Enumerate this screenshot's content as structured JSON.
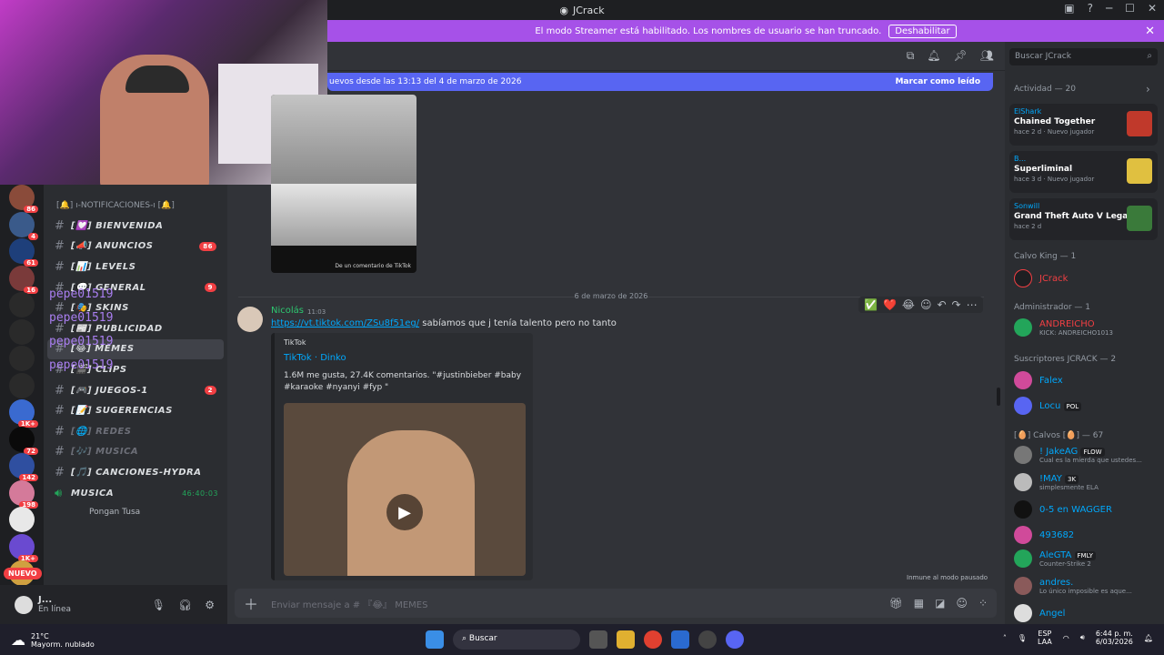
{
  "window": {
    "title": "JCrack"
  },
  "streamer_bar": {
    "message": "El modo Streamer está habilitado. Los nombres de usuario se han truncado.",
    "button": "Deshabilitar"
  },
  "new_messages_bar": {
    "text": "uevos desde las 13:13 del 4 de marzo de 2026",
    "action": "Marcar como leído"
  },
  "servers": [
    {
      "badge": "86",
      "color": "#8a4b3a"
    },
    {
      "badge": "4",
      "color": "#3a5a8a"
    },
    {
      "badge": "61",
      "color": "#1e3f7a"
    },
    {
      "badge": "16",
      "color": "#7a3a3a"
    },
    {
      "badge": "",
      "color": "#2a2a2a"
    },
    {
      "badge": "",
      "color": "#2a2a2a"
    },
    {
      "badge": "",
      "color": "#2a2a2a"
    },
    {
      "badge": "",
      "color": "#2a2a2a"
    },
    {
      "badge": "1K+",
      "color": "#3a6ad0"
    },
    {
      "badge": "72",
      "color": "#0a0a0a"
    },
    {
      "badge": "142",
      "color": "#2f4fa0"
    },
    {
      "badge": "198",
      "color": "#d47a9a"
    },
    {
      "badge": "",
      "color": "#e8e8e8"
    },
    {
      "badge": "1K+",
      "color": "#6a4ad0"
    },
    {
      "badge": "",
      "color": "#d0a040"
    }
  ],
  "nuevo": "NUEVO",
  "channels": {
    "category1": "[🔔] ı-NOTIFICACIONES-ı [🔔]",
    "items": [
      {
        "name": "[💟] BIENVENIDA",
        "count": "",
        "muted": false
      },
      {
        "name": "[📣] ANUNCIOS",
        "count": "86",
        "muted": false
      },
      {
        "name": "[📊] LEVELS",
        "count": "",
        "muted": false
      },
      {
        "name": "[💬] GENERAL",
        "count": "9",
        "muted": false
      },
      {
        "name": "[🎭] SKINS",
        "count": "",
        "muted": false
      },
      {
        "name": "[📰] PUBLICIDAD",
        "count": "",
        "muted": false
      },
      {
        "name": "[😂] MEMES",
        "count": "",
        "muted": false,
        "active": true
      },
      {
        "name": "[🎬] CLIPS",
        "count": "",
        "muted": false
      },
      {
        "name": "[🎮] JUEGOS-1",
        "count": "2",
        "muted": false
      },
      {
        "name": "[📝] SUGERENCIAS",
        "count": "",
        "muted": false
      },
      {
        "name": "[🌐] REDES",
        "count": "",
        "muted": true
      },
      {
        "name": "[🎶] MUSICA",
        "count": "",
        "muted": true
      },
      {
        "name": "[🎵] CANCIONES-HYDRA",
        "count": "",
        "muted": false
      }
    ],
    "voice": {
      "name": "MUSICA",
      "time": "46:40:03",
      "user": "Pongan Tusa"
    },
    "overlay_user": "pepe01519"
  },
  "user_panel": {
    "name": "J...",
    "status": "En línea"
  },
  "message": {
    "date_separator": "6 de marzo de 2026",
    "author": "Nicolás",
    "time": "11:03",
    "link": "https://vt.tiktok.com/ZSu8f51eg/",
    "text": "sabíamos que j tenía talento pero no tanto",
    "embed": {
      "provider": "TikTok",
      "title": "TikTok · Dinko",
      "description": "1.6M me gusta, 27.4K comentarios. \"#justinbieber #baby #karaoke #nyanyi #fyp \""
    }
  },
  "image_caption": "De un comentario de TikTok",
  "immune": "Inmune al modo pausado",
  "composer": {
    "placeholder": "Enviar mensaje a # 『😂』 MEMES"
  },
  "search": {
    "placeholder": "Buscar JCrack"
  },
  "activity": {
    "title": "Actividad — 20",
    "cards": [
      {
        "user": "ElShark",
        "game": "Chained Together",
        "meta": "hace 2 d · Nuevo jugador",
        "color": "#c0392b"
      },
      {
        "user": "B...",
        "game": "Superliminal",
        "meta": "hace 3 d · Nuevo jugador",
        "color": "#e0c040"
      },
      {
        "user": "Sonwill",
        "game": "Grand Theft Auto V Legacy",
        "meta": "hace 2 d",
        "color": "#3a7a3a"
      }
    ]
  },
  "members": {
    "calvo_king": "Calvo King — 1",
    "jcrack": "JCrack",
    "admin_title": "Administrador — 1",
    "admin": "ANDREICHO",
    "admin_sub": "KICK: ANDREICHO1013",
    "subs_title": "Suscriptores JCRACK — 2",
    "subs": [
      {
        "name": "Falex",
        "tag": ""
      },
      {
        "name": "Locu",
        "tag": "POL"
      }
    ],
    "calvos_title": "[🥚] Calvos [🥚] — 67",
    "calvos": [
      {
        "name": "! JakeAG",
        "tag": "FLOW",
        "sub": "Cual es la mierda que ustedes..."
      },
      {
        "name": "!MAY",
        "tag": "3K",
        "sub": "simplesmente ELA"
      },
      {
        "name": "0-5 en WAGGER",
        "tag": "",
        "sub": ""
      },
      {
        "name": "493682",
        "tag": "",
        "sub": ""
      },
      {
        "name": "AleGTA",
        "tag": "FMLY",
        "sub": "Counter-Strike 2"
      },
      {
        "name": "andres.",
        "tag": "",
        "sub": "Lo único imposible es aque..."
      },
      {
        "name": "Angel",
        "tag": "",
        "sub": ""
      }
    ]
  },
  "taskbar": {
    "temp": "21°C",
    "weather": "Mayorm. nublado",
    "search": "Buscar",
    "lang": "ESP",
    "lang2": "LAA",
    "time": "6:44 p. m.",
    "date": "6/03/2026"
  }
}
